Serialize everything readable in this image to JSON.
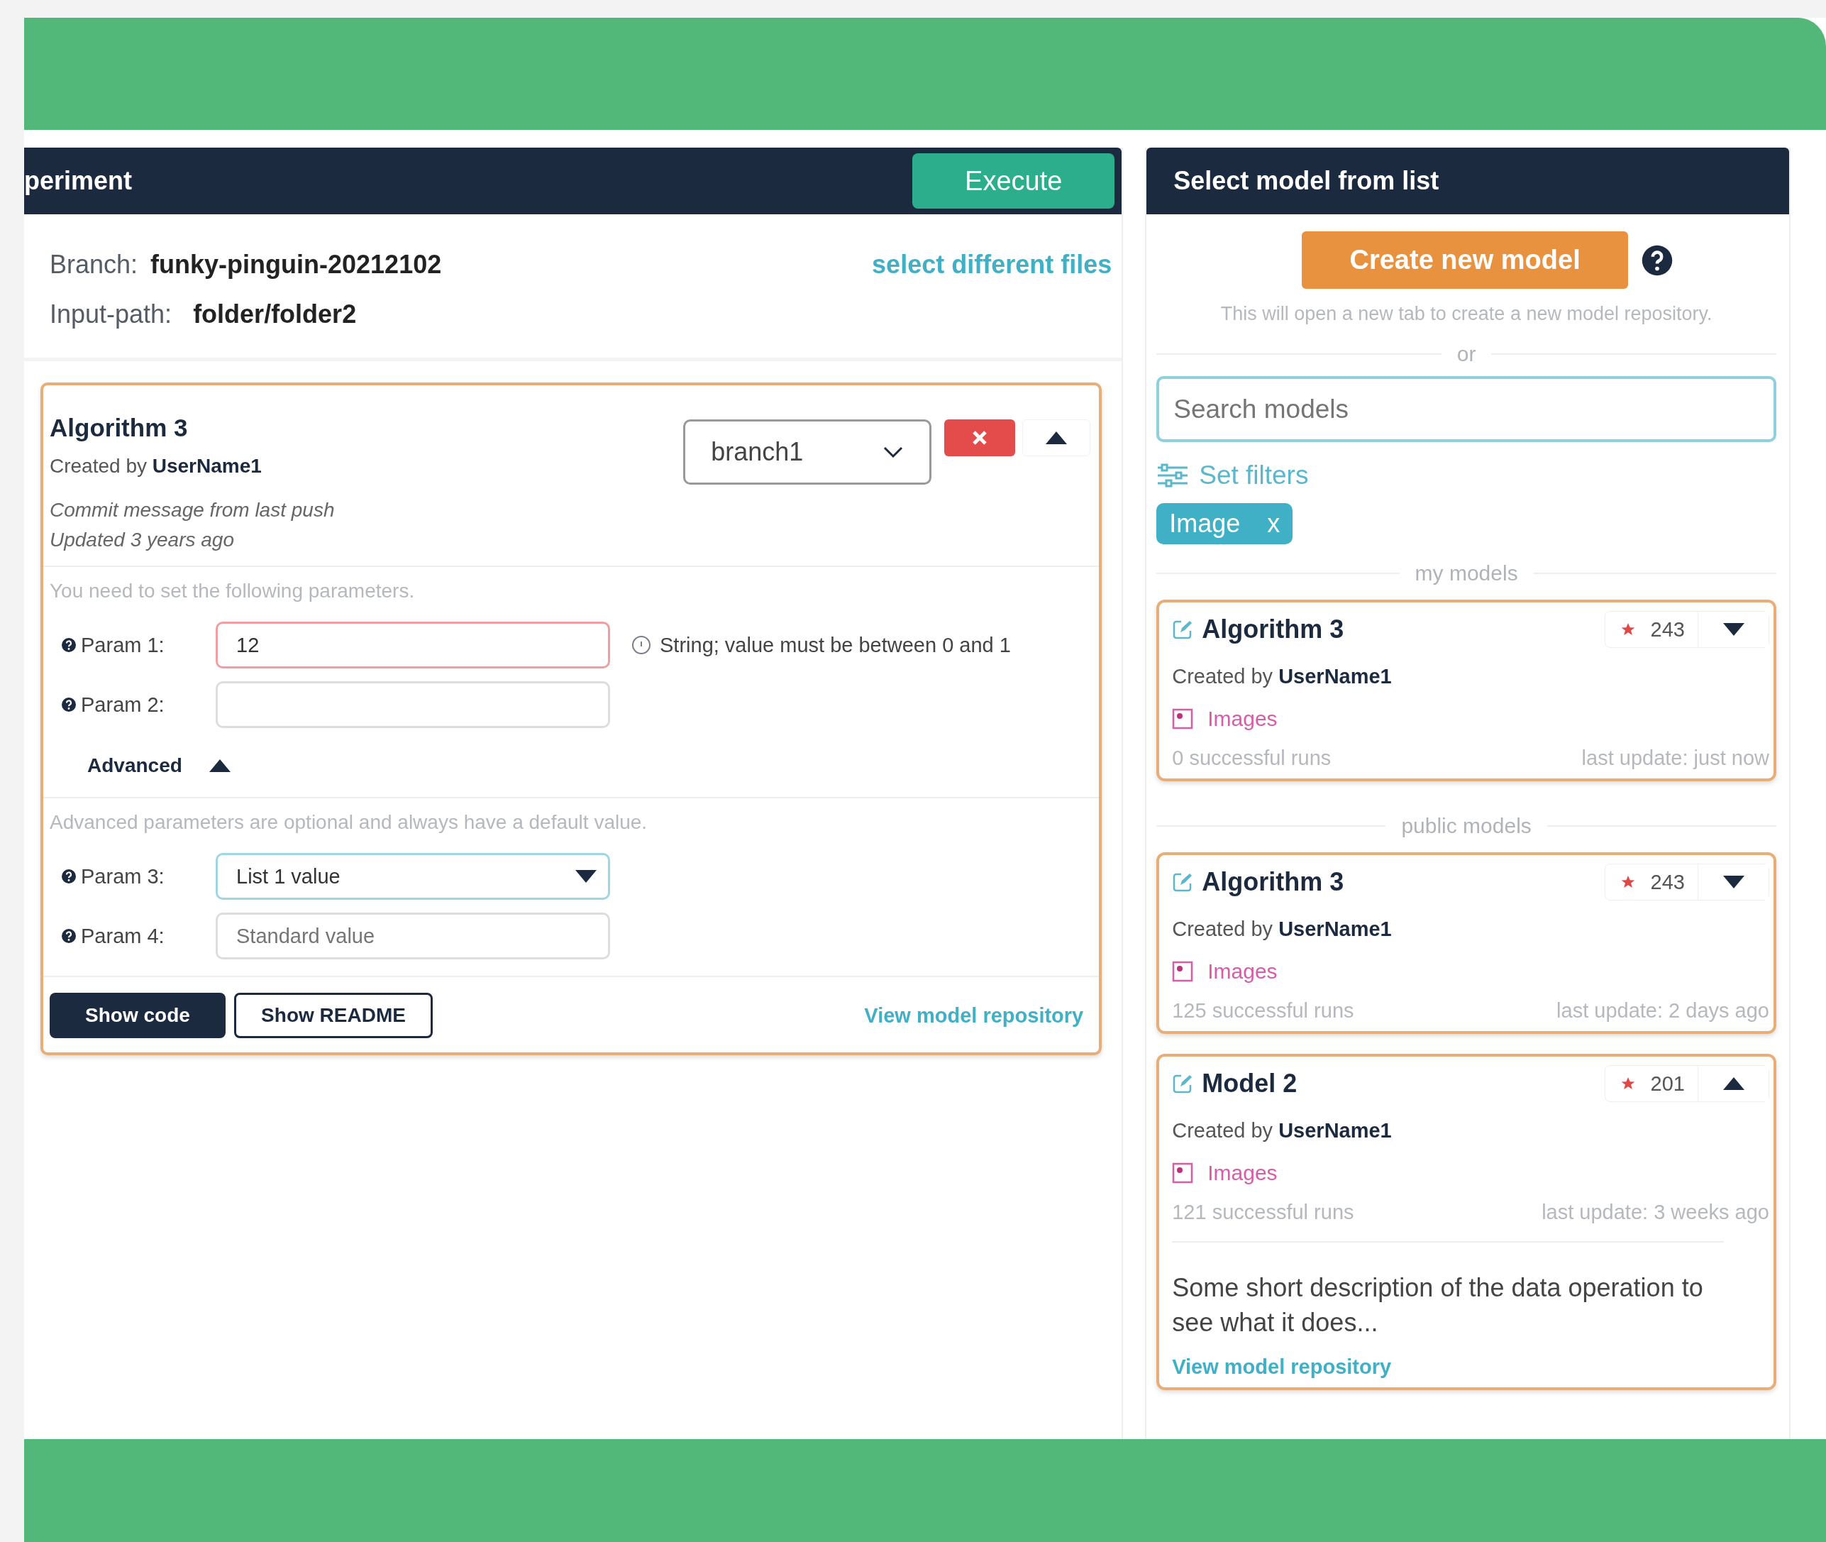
{
  "left_panel": {
    "title": "periment",
    "execute_button": "Execute",
    "branch": {
      "label": "Branch:",
      "value": "funky-pinguin-20212102"
    },
    "input_path": {
      "label": "Input-path:",
      "value": "folder/folder2"
    },
    "select_files_link": "select different files",
    "algorithm_card": {
      "title": "Algorithm 3",
      "created_by": "Created by **UserName1**",
      "commit_message": "Commit message from last push",
      "updated": "Updated 3 years ago",
      "branch_select": "branch1",
      "expanded": true,
      "params_intro": "You need to set the following parameters.",
      "params": [
        {
          "label": "Param 1:",
          "kind": "text",
          "value": "12",
          "invalid": true,
          "focused": false,
          "hint": "String; value must be between 0 and 1"
        },
        {
          "label": "Param 2:",
          "kind": "text",
          "invalid": false,
          "focused": false
        }
      ],
      "advanced": {
        "label": "Advanced",
        "expanded": true,
        "intro": "Advanced parameters are optional and always have a default value.",
        "params": [
          {
            "label": "Param 3:",
            "kind": "select",
            "value": "List 1 value",
            "invalid": false,
            "focused": true
          },
          {
            "label": "Param 4:",
            "kind": "text",
            "placeholder": "Standard value",
            "invalid": false,
            "focused": false
          }
        ]
      },
      "buttons": [
        {
          "label": "Show code",
          "kind": "primary"
        },
        {
          "label": "Show README",
          "kind": "outline"
        }
      ],
      "repo_link": "View model repository"
    }
  },
  "right_panel": {
    "title": "Select model from list",
    "create_button": "Create new model",
    "create_hint": "This will open a new tab to create a new model repository.",
    "or_label": "or",
    "search": {
      "placeholder": "Search models"
    },
    "filters_link": "Set filters",
    "filter_chips": [
      {
        "label": "Image",
        "remove": "x"
      }
    ],
    "sections": [
      {
        "label": "my models",
        "models": [
          {
            "title": "Algorithm 3",
            "stars_count": "243",
            "expanded": false,
            "created_by": "Created by **UserName1**",
            "tag": "Images",
            "runs": "0 successful runs",
            "last_update": "last update: just now"
          }
        ]
      },
      {
        "label": "public models",
        "models": [
          {
            "title": "Algorithm 3",
            "stars_count": "243",
            "expanded": false,
            "created_by": "Created by **UserName1**",
            "tag": "Images",
            "runs": "125 successful runs",
            "last_update": "last update: 2 days ago"
          },
          {
            "title": "Model 2",
            "stars_count": "201",
            "expanded": true,
            "created_by": "Created by **UserName1**",
            "tag": "Images",
            "runs": "121 successful runs",
            "last_update": "last update: 3 weeks ago",
            "description": "Some short description of the data operation to see what it does...",
            "repo_link": "View model repository"
          }
        ]
      }
    ]
  }
}
